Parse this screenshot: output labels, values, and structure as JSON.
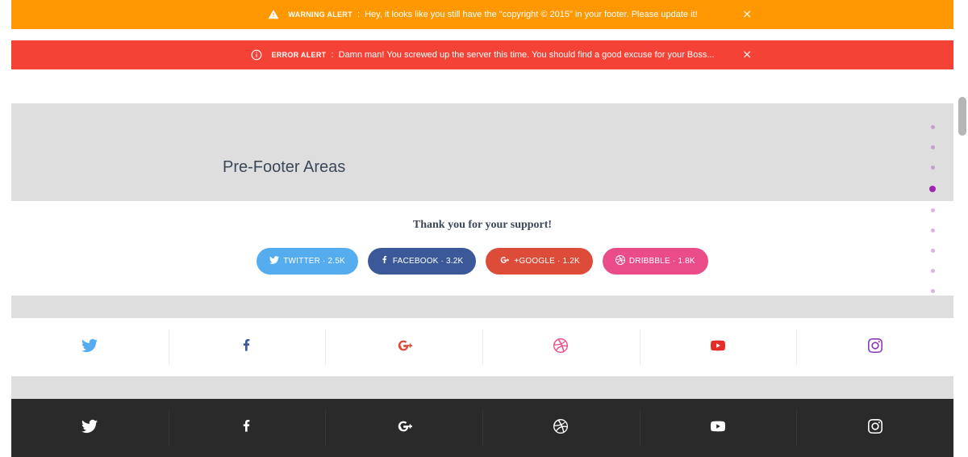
{
  "alerts": {
    "warning": {
      "label": "WARNING ALERT",
      "sep": ":",
      "message": "Hey, it looks like you still have the \"copyright © 2015\" in your footer. Please update it!"
    },
    "error": {
      "label": "ERROR ALERT",
      "sep": ":",
      "message": "Damn man! You screwed up the server this time. You should find a good excuse for your Boss..."
    }
  },
  "section_title": "Pre-Footer Areas",
  "support": {
    "title": "Thank you for your support!",
    "twitter": "TWITTER · 2.5K",
    "facebook": "FACEBOOK · 3.2K",
    "google": "+GOOGLE · 1.2K",
    "dribbble": "DRIBBBLE · 1.8K"
  },
  "colors": {
    "twitter": "#55acee",
    "facebook": "#3b5998",
    "google": "#dd4b39",
    "dribbble": "#ea4c89",
    "youtube": "#e52d27",
    "instagram": "#8a3ab9"
  },
  "pager": {
    "total": 9,
    "active_index": 3
  }
}
